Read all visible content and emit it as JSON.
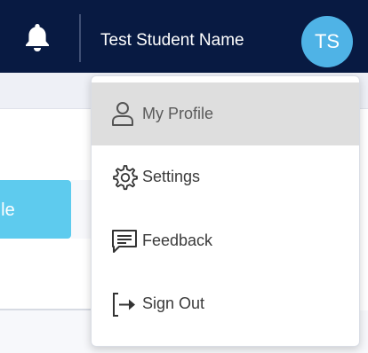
{
  "header": {
    "user_name": "Test Student Name",
    "avatar_initials": "TS",
    "icons": {
      "notifications": "bell-icon"
    },
    "colors": {
      "background": "#081a42",
      "avatar": "#4fb3e6"
    }
  },
  "background_page": {
    "profile_card_label": "Profile",
    "colors": {
      "card": "#5ecbee"
    }
  },
  "user_menu": {
    "items": [
      {
        "label": "My Profile",
        "icon": "person-icon",
        "active": true
      },
      {
        "label": "Settings",
        "icon": "gear-icon",
        "active": false
      },
      {
        "label": "Feedback",
        "icon": "feedback-icon",
        "active": false
      },
      {
        "label": "Sign Out",
        "icon": "sign-out-icon",
        "active": false
      }
    ],
    "colors": {
      "active_background": "#dedede"
    }
  }
}
